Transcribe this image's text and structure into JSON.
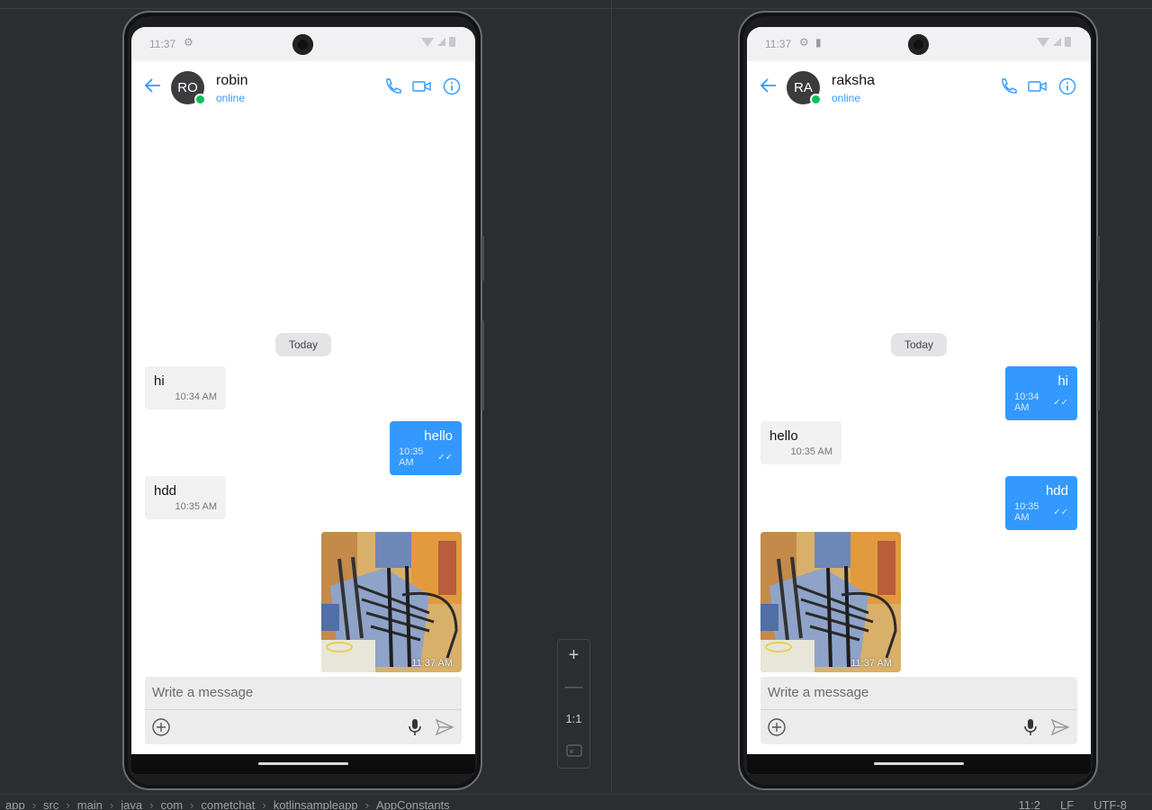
{
  "left_phone": {
    "status_time": "11:37",
    "contact_name": "robin",
    "contact_initials": "RO",
    "contact_status": "online",
    "date_chip": "Today",
    "messages": [
      {
        "text": "hi",
        "time": "10:34 AM",
        "direction": "in"
      },
      {
        "text": "hello",
        "time": "10:35 AM",
        "direction": "out"
      },
      {
        "text": "hdd",
        "time": "10:35 AM",
        "direction": "in"
      }
    ],
    "image_message": {
      "time": "11:37 AM",
      "direction": "out"
    },
    "composer_placeholder": "Write a message"
  },
  "right_phone": {
    "status_time": "11:37",
    "contact_name": "raksha",
    "contact_initials": "RA",
    "contact_status": "online",
    "date_chip": "Today",
    "messages": [
      {
        "text": "hi",
        "time": "10:34 AM",
        "direction": "out"
      },
      {
        "text": "hello",
        "time": "10:35 AM",
        "direction": "in"
      },
      {
        "text": "hdd",
        "time": "10:35 AM",
        "direction": "out"
      }
    ],
    "image_message": {
      "time": "11:37 AM",
      "direction": "in"
    },
    "composer_placeholder": "Write a message"
  },
  "zoom_controls": {
    "zoom_in": "+",
    "zoom_out": "—",
    "ratio": "1:1"
  },
  "ide_status": {
    "breadcrumbs": [
      "app",
      "src",
      "main",
      "java",
      "com",
      "cometchat",
      "kotlinsampleapp",
      "AppConstants"
    ],
    "cursor": "11:2",
    "line_ending": "LF",
    "encoding": "UTF-8"
  },
  "colors": {
    "accent": "#3399ff",
    "online_dot": "#0bbf59",
    "background": "#2b2d30"
  }
}
